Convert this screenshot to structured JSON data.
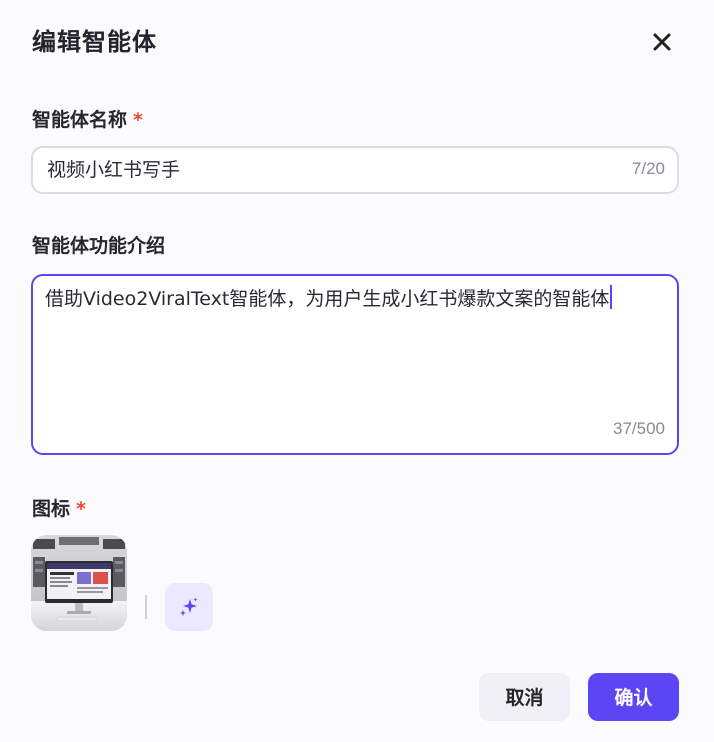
{
  "dialog": {
    "title": "编辑智能体"
  },
  "name_field": {
    "label": "智能体名称",
    "required_mark": "*",
    "value": "视频小红书写手",
    "counter": "7/20"
  },
  "description_field": {
    "label": "智能体功能介绍",
    "value": "借助Video2ViralText智能体，为用户生成小红书爆款文案的智能体",
    "counter": "37/500"
  },
  "icon_field": {
    "label": "图标",
    "required_mark": "*",
    "ai_generate_icon": "sparkle-icon"
  },
  "footer": {
    "cancel_label": "取消",
    "confirm_label": "确认"
  },
  "colors": {
    "accent": "#5b45f5",
    "required": "#f0462e",
    "ai_button_bg": "#ece8fd"
  }
}
